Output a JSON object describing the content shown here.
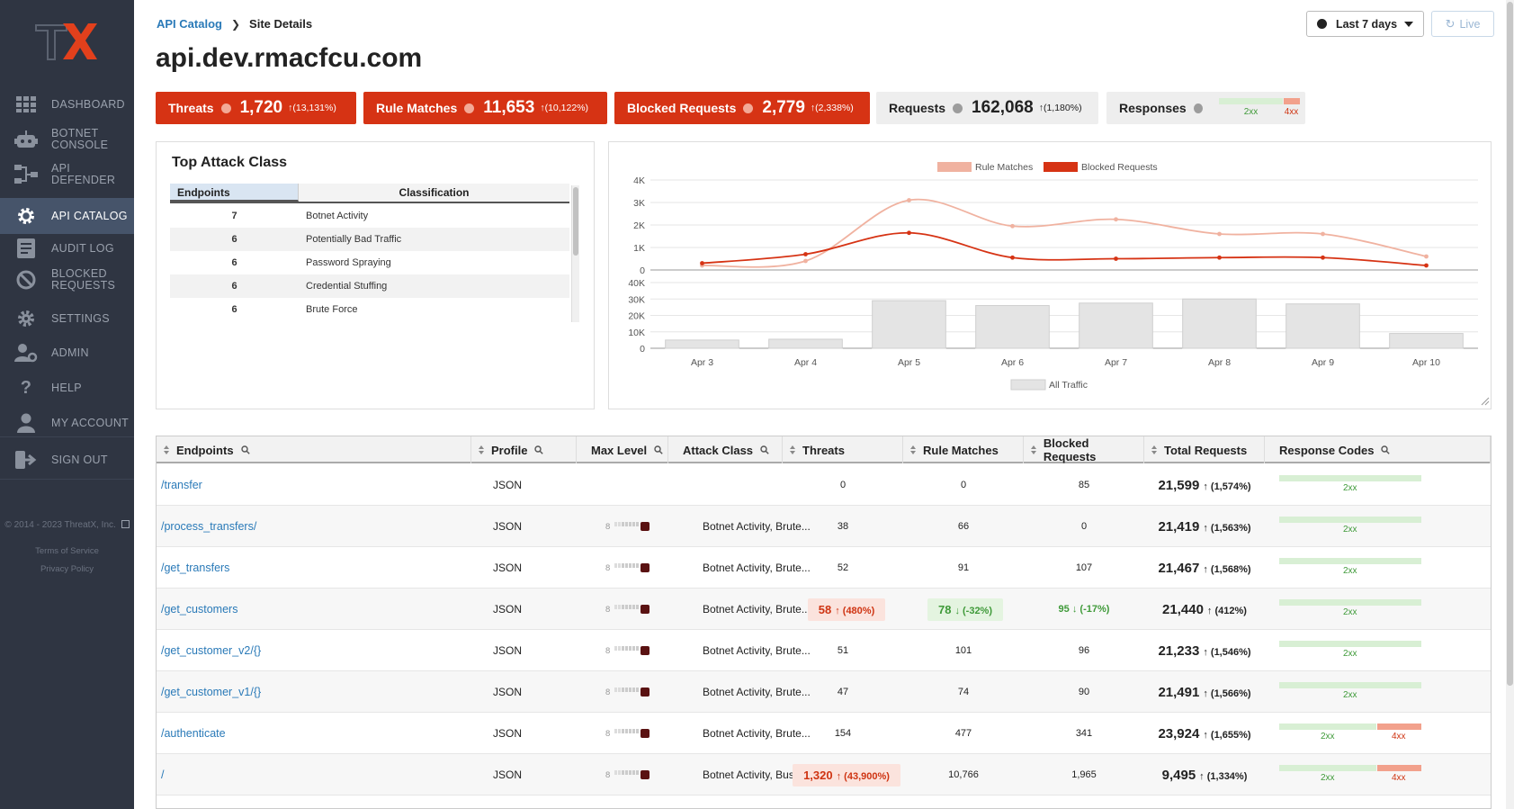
{
  "app": {
    "logo_text": "TX"
  },
  "sidebar": {
    "items": [
      {
        "label": "Dashboard",
        "icon": "grid-icon"
      },
      {
        "label": "Botnet Console",
        "icon": "robot-icon"
      },
      {
        "label": "API Defender",
        "icon": "network-icon"
      },
      {
        "label": "API Catalog",
        "icon": "gear-icon",
        "active": true
      },
      {
        "label": "Audit Log",
        "icon": "log-icon"
      },
      {
        "label": "Blocked Requests",
        "icon": "block-icon"
      },
      {
        "label": "Settings",
        "icon": "cog-icon"
      },
      {
        "label": "Admin",
        "icon": "user-gear-icon"
      },
      {
        "label": "Help",
        "icon": "question-icon"
      },
      {
        "label": "My Account",
        "icon": "user-icon"
      },
      {
        "label": "Sign Out",
        "icon": "signout-icon"
      }
    ],
    "copyright": "© 2014 - 2023 ThreatX, Inc.",
    "terms": "Terms of Service",
    "privacy": "Privacy Policy"
  },
  "header": {
    "breadcrumb_root": "API Catalog",
    "breadcrumb_current": "Site Details",
    "title": "api.dev.rmacfcu.com",
    "date_range": "Last 7 days",
    "live_label": "Live"
  },
  "metrics": [
    {
      "label": "Threats",
      "value": "1,720",
      "change": "(13,131%)"
    },
    {
      "label": "Rule Matches",
      "value": "11,653",
      "change": "(10,122%)"
    },
    {
      "label": "Blocked Requests",
      "value": "2,779",
      "change": "(2,338%)"
    },
    {
      "label": "Requests",
      "value": "162,068",
      "change": "(1,180%)"
    },
    {
      "label": "Responses",
      "bar_2xx": "2xx",
      "bar_4xx": "4xx",
      "share_2xx": 0.8,
      "share_4xx": 0.2
    }
  ],
  "attack_panel": {
    "title": "Top Attack Class",
    "col_endpoints": "Endpoints",
    "col_classification": "Classification",
    "rows": [
      {
        "count": "7",
        "class": "Botnet Activity"
      },
      {
        "count": "6",
        "class": "Potentially Bad Traffic"
      },
      {
        "count": "6",
        "class": "Password Spraying"
      },
      {
        "count": "6",
        "class": "Credential Stuffing"
      },
      {
        "count": "6",
        "class": "Brute Force"
      }
    ]
  },
  "chart_data": {
    "type": "line",
    "categories": [
      "Apr 3",
      "Apr 4",
      "Apr 5",
      "Apr 6",
      "Apr 7",
      "Apr 8",
      "Apr 9",
      "Apr 10"
    ],
    "series": [
      {
        "name": "Rule Matches",
        "values": [
          200,
          400,
          3100,
          1950,
          2250,
          1600,
          1600,
          600
        ],
        "color": "#f0b2a0"
      },
      {
        "name": "Blocked Requests",
        "values": [
          300,
          700,
          1650,
          550,
          500,
          550,
          550,
          200
        ],
        "color": "#d63314"
      }
    ],
    "top_ylim": [
      0,
      4000
    ],
    "top_yticks": [
      "0",
      "1K",
      "2K",
      "3K",
      "4K"
    ],
    "bars": {
      "name": "All Traffic",
      "values": [
        5000,
        5500,
        29000,
        26000,
        27500,
        30000,
        27000,
        9000
      ],
      "color": "#e4e4e4"
    },
    "bottom_ylim": [
      0,
      40000
    ],
    "bottom_yticks": [
      "0",
      "10K",
      "20K",
      "30K",
      "40K"
    ],
    "legend_top": "top-center",
    "legend_bottom": "bottom-center"
  },
  "table": {
    "columns": [
      "Endpoints",
      "Profile",
      "Max Level",
      "Attack Class",
      "Threats",
      "Rule Matches",
      "Blocked Requests",
      "Total Requests",
      "Response Codes"
    ],
    "rows": [
      {
        "endpoint": "/transfer",
        "profile": "JSON",
        "level": "",
        "attack": "",
        "threats": "0",
        "rule": "0",
        "blocked": "85",
        "total": "21,599",
        "total_chg": "(1,574%)",
        "r2": "2xx",
        "r4": ""
      },
      {
        "endpoint": "/process_transfers/",
        "profile": "JSON",
        "level": "8",
        "attack": "Botnet Activity, Brute...",
        "threats": "38",
        "rule": "66",
        "blocked": "0",
        "total": "21,419",
        "total_chg": "(1,563%)",
        "r2": "2xx",
        "r4": ""
      },
      {
        "endpoint": "/get_transfers",
        "profile": "JSON",
        "level": "8",
        "attack": "Botnet Activity, Brute...",
        "threats": "52",
        "rule": "91",
        "blocked": "107",
        "total": "21,467",
        "total_chg": "(1,568%)",
        "r2": "2xx",
        "r4": ""
      },
      {
        "endpoint": "/get_customers",
        "profile": "JSON",
        "level": "8",
        "attack": "Botnet Activity, Brute...",
        "threats": "58",
        "threats_chg": "(480%)",
        "rule": "78",
        "rule_chg": "(-32%)",
        "blocked": "95",
        "blocked_chg": "(-17%)",
        "total": "21,440",
        "total_chg": "(412%)",
        "r2": "2xx",
        "r4": ""
      },
      {
        "endpoint": "/get_customer_v2/{}",
        "profile": "JSON",
        "level": "8",
        "attack": "Botnet Activity, Brute...",
        "threats": "51",
        "rule": "101",
        "blocked": "96",
        "total": "21,233",
        "total_chg": "(1,546%)",
        "r2": "2xx",
        "r4": ""
      },
      {
        "endpoint": "/get_customer_v1/{}",
        "profile": "JSON",
        "level": "8",
        "attack": "Botnet Activity, Brute...",
        "threats": "47",
        "rule": "74",
        "blocked": "90",
        "total": "21,491",
        "total_chg": "(1,566%)",
        "r2": "2xx",
        "r4": ""
      },
      {
        "endpoint": "/authenticate",
        "profile": "JSON",
        "level": "8",
        "attack": "Botnet Activity, Brute...",
        "threats": "154",
        "rule": "477",
        "blocked": "341",
        "total": "23,924",
        "total_chg": "(1,655%)",
        "r2": "2xx",
        "r4": "4xx"
      },
      {
        "endpoint": "/",
        "profile": "JSON",
        "level": "8",
        "attack": "Botnet Activity, Busin...",
        "threats": "1,320",
        "threats_chg": "(43,900%)",
        "rule": "10,766",
        "blocked": "1,965",
        "total": "9,495",
        "total_chg": "(1,334%)",
        "r2": "2xx",
        "r4": "4xx"
      }
    ]
  },
  "colors": {
    "accent_red": "#d63314",
    "link_blue": "#2a7ab8",
    "sidebar_bg": "#2f3542"
  }
}
